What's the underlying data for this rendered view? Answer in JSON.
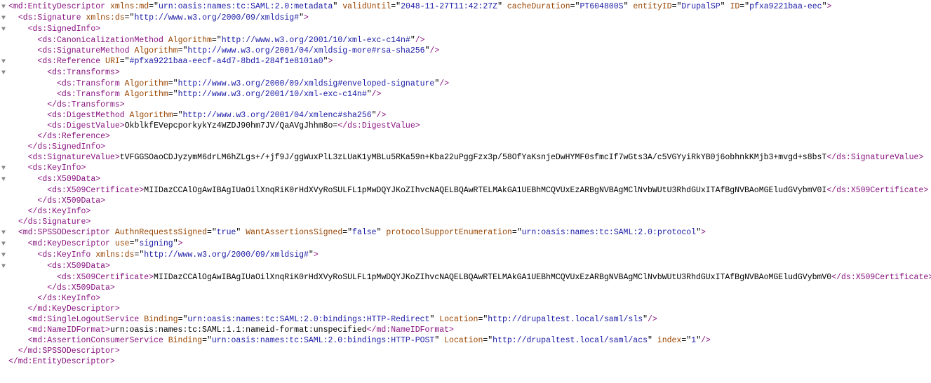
{
  "tags": {
    "entityDescriptor": "md:EntityDescriptor",
    "signature": "ds:Signature",
    "signedInfo": "ds:SignedInfo",
    "canonMethod": "ds:CanonicalizationMethod",
    "sigMethod": "ds:SignatureMethod",
    "reference": "ds:Reference",
    "transforms": "ds:Transforms",
    "transform": "ds:Transform",
    "digestMethod": "ds:DigestMethod",
    "digestValue": "ds:DigestValue",
    "signatureValue": "ds:SignatureValue",
    "keyInfo": "ds:KeyInfo",
    "x509Data": "ds:X509Data",
    "x509Cert": "ds:X509Certificate",
    "spSSO": "md:SPSSODescriptor",
    "keyDesc": "md:KeyDescriptor",
    "slo": "md:SingleLogoutService",
    "nameIDFormat": "md:NameIDFormat",
    "acs": "md:AssertionConsumerService"
  },
  "attrs": {
    "xmlnsmd": "xmlns:md",
    "xmlnsds": "xmlns:ds",
    "validUntil": "validUntil",
    "cacheDuration": "cacheDuration",
    "entityID": "entityID",
    "ID": "ID",
    "Algorithm": "Algorithm",
    "URI": "URI",
    "AuthnRequestsSigned": "AuthnRequestsSigned",
    "WantAssertionsSigned": "WantAssertionsSigned",
    "pse": "protocolSupportEnumeration",
    "use": "use",
    "Binding": "Binding",
    "Location": "Location",
    "index": "index"
  },
  "vals": {
    "mdns": "urn:oasis:names:tc:SAML:2.0:metadata",
    "dsns": "http://www.w3.org/2000/09/xmldsig#",
    "validUntil": "2048-11-27T11:42:27Z",
    "cacheDuration": "PT604800S",
    "entityID": "DrupalSP",
    "ID": "pfxa9221baa-eec",
    "c14n": "http://www.w3.org/2001/10/xml-exc-c14n#",
    "rsasha256": "http://www.w3.org/2001/04/xmldsig-more#rsa-sha256",
    "refURI": "#pfxa9221baa-eecf-a4d7-8bd1-284f1e8101a0",
    "envsig": "http://www.w3.org/2000/09/xmldsig#enveloped-signature",
    "sha256": "http://www.w3.org/2001/04/xmlenc#sha256",
    "digestValue": "OkblkfEVepcporkykYz4WZDJ90hm7JV/QaAVgJhhm8o=",
    "sigValue": "tVFGGSOaoCDJyzymM6drLM6hZLgs+/+jf9J/ggWuxPlL3zLUaK1yMBLu5RKa59n+Kba22uPggFzx3p/58OfYaKsnjeDwHYMF0sfmcIf7wGts3A/c5VGYyiRkYB0j6obhnkKMjb3+mvgd+s8bsT",
    "cert": "MIIDazCCAlOgAwIBAgIUaOilXnqRiK0rHdXVyRoSULFL1pMwDQYJKoZIhvcNAQELBQAwRTELMAkGA1UEBhMCQVUxEzARBgNVBAgMClNvbWUtU3RhdGUxITAfBgNVBAoMGEludGVybmV0I",
    "cert2": "MIIDazCCAlOgAwIBAgIUaOilXnqRiK0rHdXVyRoSULFL1pMwDQYJKoZIhvcNAQELBQAwRTELMAkGA1UEBhMCQVUxEzARBgNVBAgMClNvbWUtU3RhdGUxITAfBgNVBAoMGEludGVybmV0",
    "true": "true",
    "false": "false",
    "protocol": "urn:oasis:names:tc:SAML:2.0:protocol",
    "signing": "signing",
    "redirect": "urn:oasis:names:tc:SAML:2.0:bindings:HTTP-Redirect",
    "post": "urn:oasis:names:tc:SAML:2.0:bindings:HTTP-POST",
    "slsLoc": "http://drupaltest.local/saml/sls",
    "acsLoc": "http://drupaltest.local/saml/acs",
    "nameID": "urn:oasis:names:tc:SAML:1.1:nameid-format:unspecified",
    "idx1": "1"
  },
  "glyphs": {
    "down": "▼"
  }
}
